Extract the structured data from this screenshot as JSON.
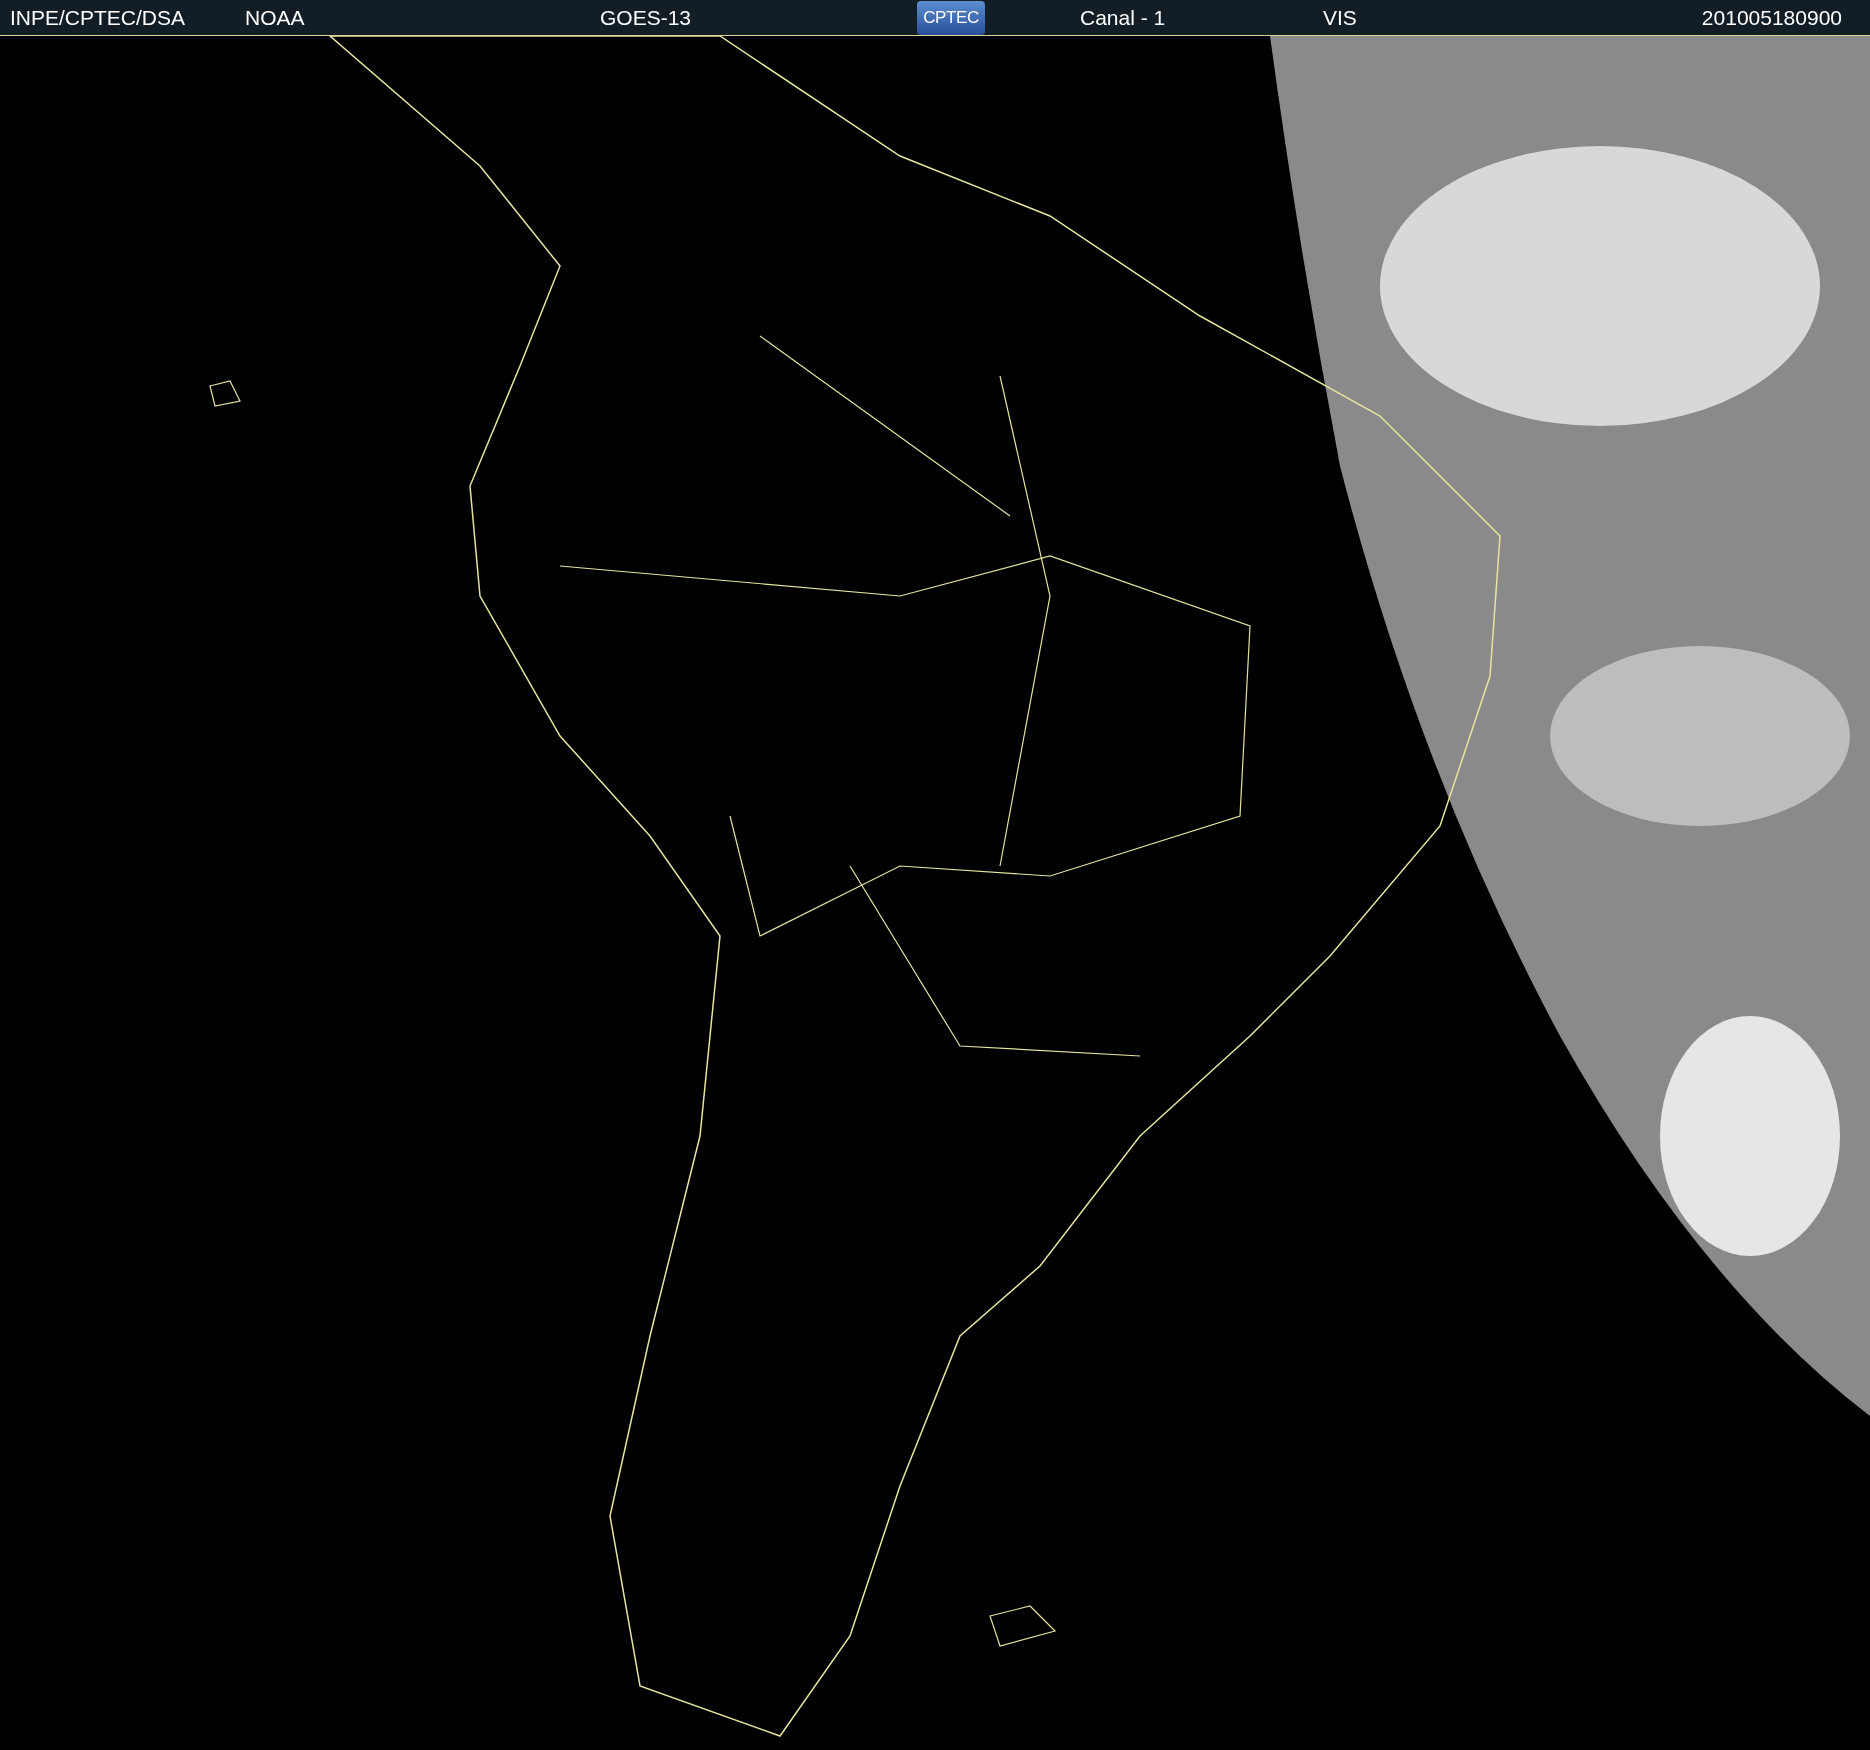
{
  "header": {
    "source": "INPE/CPTEC/DSA",
    "agency": "NOAA",
    "satellite": "GOES-13",
    "logo": "CPTEC",
    "channel": "Canal - 1",
    "band": "VIS",
    "timestamp": "201005180900"
  }
}
